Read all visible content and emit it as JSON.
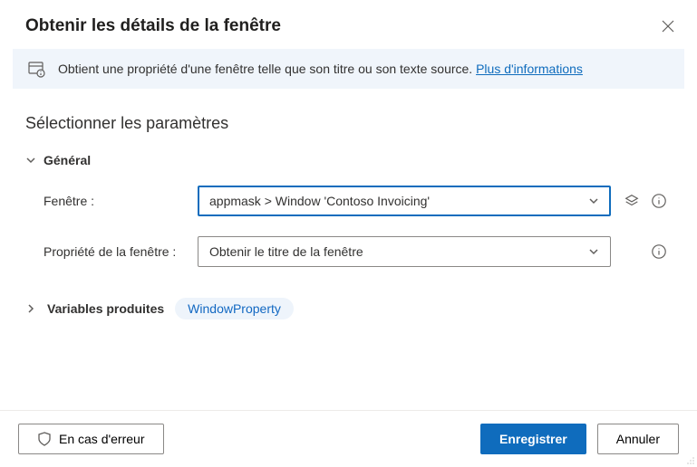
{
  "dialog": {
    "title": "Obtenir les détails de la fenêtre"
  },
  "banner": {
    "text": "Obtient une propriété d'une fenêtre telle que son titre ou son texte source. ",
    "link": "Plus d'informations"
  },
  "section": {
    "title": "Sélectionner les paramètres"
  },
  "group": {
    "general": "Général"
  },
  "fields": {
    "window": {
      "label": "Fenêtre :",
      "value": "appmask > Window 'Contoso Invoicing'"
    },
    "property": {
      "label": "Propriété de la fenêtre :",
      "value": "Obtenir le titre de la fenêtre"
    }
  },
  "variables": {
    "label": "Variables produites",
    "chip": "WindowProperty"
  },
  "footer": {
    "on_error": "En cas d'erreur",
    "save": "Enregistrer",
    "cancel": "Annuler"
  }
}
